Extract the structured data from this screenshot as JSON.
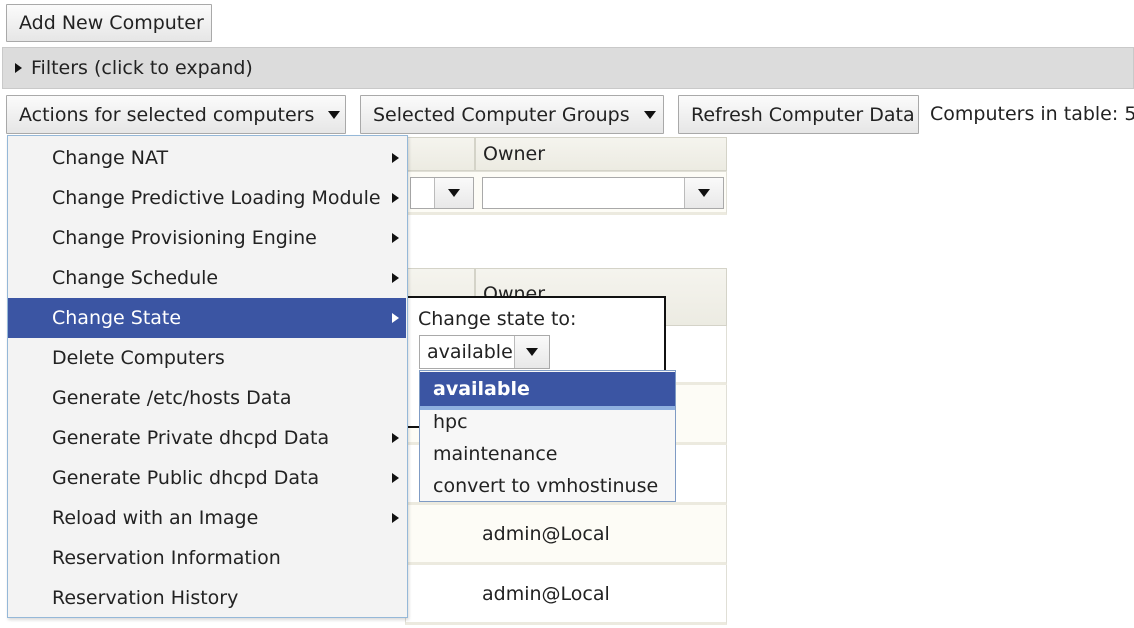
{
  "toolbar": {
    "add_new_computer": "Add New Computer",
    "filters_label": "Filters (click to expand)",
    "actions_button": "Actions for selected computers",
    "groups_button": "Selected Computer Groups",
    "refresh_button": "Refresh Computer Data",
    "count_label": "Computers in table: 5"
  },
  "table": {
    "top_header_owner": "Owner",
    "lower_header_owner": "Owner",
    "rows": [
      {
        "owner": ""
      },
      {
        "owner": ""
      },
      {
        "owner": ""
      },
      {
        "owner": "admin@Local"
      },
      {
        "owner": "admin@Local"
      }
    ]
  },
  "actions_menu": {
    "items": [
      {
        "label": "Change NAT",
        "submenu": true
      },
      {
        "label": "Change Predictive Loading Module",
        "submenu": true
      },
      {
        "label": "Change Provisioning Engine",
        "submenu": true
      },
      {
        "label": "Change Schedule",
        "submenu": true
      },
      {
        "label": "Change State",
        "submenu": true,
        "active": true
      },
      {
        "label": "Delete Computers",
        "submenu": false
      },
      {
        "label": "Generate /etc/hosts Data",
        "submenu": false
      },
      {
        "label": "Generate Private dhcpd Data",
        "submenu": true
      },
      {
        "label": "Generate Public dhcpd Data",
        "submenu": true
      },
      {
        "label": "Reload with an Image",
        "submenu": true
      },
      {
        "label": "Reservation Information",
        "submenu": false
      },
      {
        "label": "Reservation History",
        "submenu": false
      }
    ]
  },
  "change_state": {
    "label": "Change state to:",
    "selected": "available",
    "options": [
      "available",
      "hpc",
      "maintenance",
      "convert to vmhostinuse"
    ]
  },
  "colors": {
    "menu_highlight": "#3b55a3",
    "toolbar_bar": "#dcdcdc"
  }
}
